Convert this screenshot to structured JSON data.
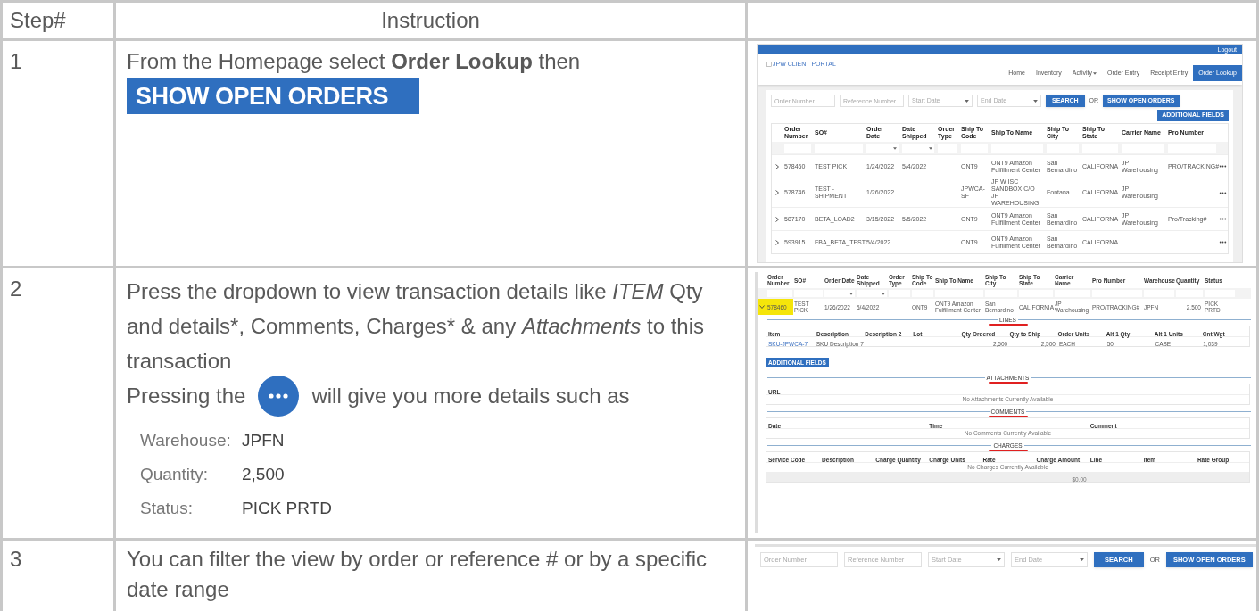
{
  "table": {
    "columns": [
      "Step#",
      "Instruction"
    ],
    "steps": [
      {
        "step": "1",
        "instruction": "From the Homepage select **Order Lookup** then",
        "button": "SHOW OPEN ORDERS",
        "screenshot": {
          "logout": "Logout",
          "logo": "JPW CLIENT PORTAL",
          "nav": [
            {
              "label": "Home",
              "selected": false,
              "dropdown": false
            },
            {
              "label": "Inventory",
              "selected": false,
              "dropdown": false
            },
            {
              "label": "Activity",
              "selected": false,
              "dropdown": true
            },
            {
              "label": "Order Entry",
              "selected": false,
              "dropdown": false
            },
            {
              "label": "Receipt Entry",
              "selected": false,
              "dropdown": false
            },
            {
              "label": "Order Lookup",
              "selected": true,
              "dropdown": false
            }
          ],
          "filters": {
            "fields": [
              {
                "kind": "text",
                "placeholder": "Order Number"
              },
              {
                "kind": "text",
                "placeholder": "Reference Number"
              },
              {
                "kind": "date",
                "placeholder": "Start Date"
              },
              {
                "kind": "date",
                "placeholder": "End Date"
              }
            ],
            "search": "SEARCH",
            "or": "OR",
            "show_open": "SHOW OPEN ORDERS"
          },
          "additional_fields": "ADDITIONAL FIELDS",
          "columns": [
            {
              "label": "Order Number",
              "kind": "text"
            },
            {
              "label": "SO#",
              "kind": "text"
            },
            {
              "label": "Order Date",
              "kind": "select"
            },
            {
              "label": "Date Shipped",
              "kind": "select"
            },
            {
              "label": "Order Type",
              "kind": "text"
            },
            {
              "label": "Ship To Code",
              "kind": "text"
            },
            {
              "label": "Ship To Name",
              "kind": "text"
            },
            {
              "label": "Ship To City",
              "kind": "text"
            },
            {
              "label": "Ship To State",
              "kind": "text"
            },
            {
              "label": "Carrier Name",
              "kind": "text"
            },
            {
              "label": "Pro Number",
              "kind": "text"
            }
          ],
          "rows": [
            [
              "578460",
              "TEST PICK",
              "1/24/2022",
              "5/4/2022",
              null,
              "ONT9",
              "ONT9 Amazon Fulfillment Center",
              "San Bernardino",
              "CALIFORNA",
              "JP Warehousing",
              "PRO/TRACKING#"
            ],
            [
              "578746",
              "TEST -SHIPMENT",
              "1/26/2022",
              null,
              null,
              "JPWCA-SF",
              "JP W ISC SANDBOX C/O JP WAREHOUSING",
              "Fontana",
              "CALIFORNA",
              "JP Warehousing",
              null
            ],
            [
              "587170",
              "BETA_LOAD2",
              "3/15/2022",
              "5/5/2022",
              null,
              "ONT9",
              "ONT9 Amazon Fulfillment Center",
              "San Bernardino",
              "CALIFORNA",
              "JP Warehousing",
              "Pro/Tracking#"
            ],
            [
              "593915",
              "FBA_BETA_TEST",
              "5/4/2022",
              null,
              null,
              "ONT9",
              "ONT9 Amazon Fulfillment Center",
              "San Bernardino",
              "CALIFORNA",
              null,
              null
            ]
          ]
        }
      },
      {
        "step": "2",
        "instruction": "Press the dropdown to view transaction details like *ITEM* Qty and details*, Comments, Charges* & any *Attachments* to this transaction",
        "pressing_before": "Pressing the",
        "pressing_after": "will give you more details such as",
        "details": [
          {
            "label": "Warehouse:",
            "value": "JPFN"
          },
          {
            "label": "Quantity:",
            "value": "2,500"
          },
          {
            "label": "Status:",
            "value": "PICK PRTD"
          }
        ],
        "screenshot": {
          "columns": [
            {
              "label": "Order Number",
              "kind": "text"
            },
            {
              "label": "SO#",
              "kind": "text"
            },
            {
              "label": "Order Date",
              "kind": "select"
            },
            {
              "label": "Date Shipped",
              "kind": "select"
            },
            {
              "label": "Order Type",
              "kind": "text"
            },
            {
              "label": "Ship To Code",
              "kind": "text"
            },
            {
              "label": "Ship To Name",
              "kind": "text"
            },
            {
              "label": "Ship To City",
              "kind": "text"
            },
            {
              "label": "Ship To State",
              "kind": "text"
            },
            {
              "label": "Carrier Name",
              "kind": "text"
            },
            {
              "label": "Pro Number",
              "kind": "text"
            },
            {
              "label": "Warehouse",
              "kind": "text"
            },
            {
              "label": "Quantity",
              "kind": "text"
            },
            {
              "label": "Status",
              "kind": "text"
            }
          ],
          "row": {
            "expanded": true,
            "selected": true,
            "cells": [
              "578460",
              "TEST PICK",
              "1/26/2022",
              "5/4/2022",
              null,
              "ONT9",
              "ONT9 Amazon Fulfillment Center",
              "San Bernardino",
              "CALIFORNIA",
              "JP Warehousing",
              "PRO/TRACKING#",
              "JPFN",
              "2,500",
              "PICK PRTD"
            ]
          },
          "sections": [
            {
              "kind": "table",
              "title": "LINES",
              "columns": [
                "Item",
                "Description",
                "Description 2",
                "Lot",
                "Qty Ordered",
                "Qty to Ship",
                "Order Units",
                "Alt 1 Qty",
                "Alt 1 Units",
                "Cnt Wgt"
              ],
              "rows": [
                [
                  "SKU-JPWCA-7",
                  "SKU Description 7",
                  null,
                  null,
                  "2,500",
                  "2,500",
                  "EACH",
                  "50",
                  "CASE",
                  "1,039"
                ]
              ],
              "button": "ADDITIONAL FIELDS"
            },
            {
              "kind": "empty",
              "title": "ATTACHMENTS",
              "columns": [
                "URL"
              ],
              "empty": "No Attachments Currently Available"
            },
            {
              "kind": "empty",
              "title": "COMMENTS",
              "columns": [
                "Date",
                "Time",
                "Comment"
              ],
              "empty": "No Comments Currently Available"
            },
            {
              "kind": "empty",
              "title": "CHARGES",
              "columns": [
                "Service Code",
                "Description",
                "Charge Quantity",
                "Charge Units",
                "Rate",
                "Charge Amount",
                "Line",
                "Item",
                "Rate Group"
              ],
              "empty": "No Charges Currently Available",
              "total": "$0.00"
            }
          ]
        }
      },
      {
        "step": "3",
        "instruction": "You can filter the view by order or reference # or by a specific date range",
        "screenshot": {
          "filters": {
            "fields": [
              {
                "kind": "text",
                "placeholder": "Order Number"
              },
              {
                "kind": "text",
                "placeholder": "Reference Number"
              },
              {
                "kind": "date",
                "placeholder": "Start Date"
              },
              {
                "kind": "date",
                "placeholder": "End Date"
              }
            ],
            "search": "SEARCH",
            "or": "OR",
            "show_open": "SHOW OPEN ORDERS"
          }
        }
      }
    ]
  }
}
